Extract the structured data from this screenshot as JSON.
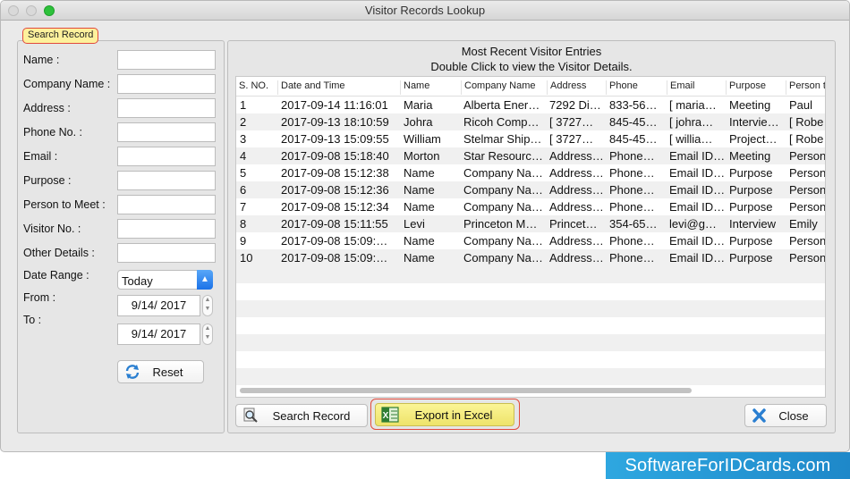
{
  "window": {
    "title": "Visitor Records Lookup"
  },
  "search_panel": {
    "badge": "Search Record",
    "fields": [
      {
        "label": "Name :",
        "value": ""
      },
      {
        "label": "Company Name :",
        "value": ""
      },
      {
        "label": "Address :",
        "value": ""
      },
      {
        "label": "Phone No. :",
        "value": ""
      },
      {
        "label": "Email :",
        "value": ""
      },
      {
        "label": "Purpose :",
        "value": ""
      },
      {
        "label": "Person to Meet :",
        "value": ""
      },
      {
        "label": "Visitor No. :",
        "value": ""
      },
      {
        "label": "Other Details :",
        "value": ""
      }
    ],
    "date_range_label": "Date Range :",
    "date_range_value": "Today",
    "from_label": "From :",
    "from_value": "9/14/ 2017",
    "to_label": "To :",
    "to_value": "9/14/ 2017",
    "reset_label": "Reset"
  },
  "records": {
    "heading": "Most Recent Visitor Entries",
    "subheading": "Double Click to view the Visitor Details.",
    "columns": [
      "S. NO.",
      "Date and Time",
      "Name",
      "Company Name",
      "Address",
      "Phone",
      "Email",
      "Purpose",
      "Person t"
    ],
    "rows": [
      [
        "1",
        "2017-09-14 11:16:01",
        "Maria",
        "Alberta Ener…",
        "7292 Di…",
        "833-56…",
        "[ maria…",
        "Meeting",
        "Paul"
      ],
      [
        "2",
        "2017-09-13 18:10:59",
        "Johra",
        "Ricoh Comp…",
        "[ 3727…",
        "845-45…",
        "[ johra…",
        "Intervie…",
        "[ Robe"
      ],
      [
        "3",
        "2017-09-13 15:09:55",
        "William",
        "Stelmar Ship…",
        "[ 3727…",
        "845-45…",
        "[ willia…",
        "Project…",
        "[ Robe"
      ],
      [
        "4",
        "2017-09-08 15:18:40",
        "Morton",
        "Star Resourc…",
        "Address…",
        "Phone…",
        "Email ID…",
        "Meeting",
        "Person"
      ],
      [
        "5",
        "2017-09-08 15:12:38",
        "Name",
        "Company Na…",
        "Address…",
        "Phone…",
        "Email ID…",
        "Purpose",
        "Person"
      ],
      [
        "6",
        "2017-09-08 15:12:36",
        "Name",
        "Company Na…",
        "Address…",
        "Phone…",
        "Email ID…",
        "Purpose",
        "Person"
      ],
      [
        "7",
        "2017-09-08 15:12:34",
        "Name",
        "Company Na…",
        "Address…",
        "Phone…",
        "Email ID…",
        "Purpose",
        "Person"
      ],
      [
        "8",
        "2017-09-08 15:11:55",
        "Levi",
        "Princeton M…",
        "Princet…",
        "354-65…",
        "levi@g…",
        "Interview",
        "Emily"
      ],
      [
        "9",
        "2017-09-08 15:09:…",
        "Name",
        "Company Na…",
        "Address…",
        "Phone…",
        "Email ID…",
        "Purpose",
        "Person"
      ],
      [
        "10",
        "2017-09-08 15:09:…",
        "Name",
        "Company Na…",
        "Address…",
        "Phone…",
        "Email ID…",
        "Purpose",
        "Person"
      ]
    ]
  },
  "buttons": {
    "search_record": "Search Record",
    "export_excel": "Export  in Excel",
    "close": "Close"
  },
  "watermark": "SoftwareForIDCards.com",
  "colors": {
    "highlight_border": "#e14a3c",
    "badge_fill": "#fdf19c",
    "export_fill": "#eee36a",
    "select_accent": "#1b72e8",
    "watermark_bg": "#1e88c9"
  }
}
